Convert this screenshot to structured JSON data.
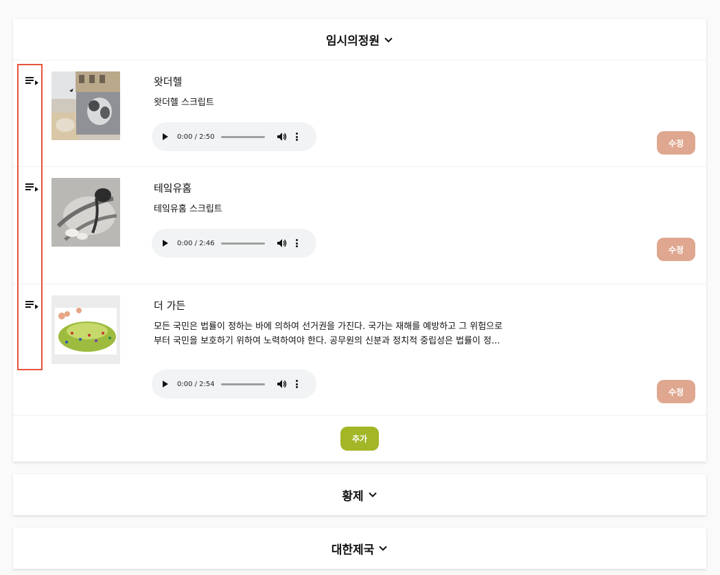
{
  "sections": [
    {
      "title": "임시의정원",
      "expanded": true,
      "items": [
        {
          "title": "왓더헬",
          "description": "왓더헬 스크립트",
          "audio_time": "0:00 / 2:50",
          "edit_label": "수정",
          "thumbnail_icon": "street-and-dog-photo"
        },
        {
          "title": "테잌유홈",
          "description": "테잌유홈 스크립트",
          "audio_time": "0:00 / 2:46",
          "edit_label": "수정",
          "thumbnail_icon": "cat-photo"
        },
        {
          "title": "더 가든",
          "description_line1": "모든 국민은 법률이 정하는 바에 의하여 선거권을 가진다. 국가는 재해를 예방하고 그 위험으로",
          "description_line2": "부터 국민을 보호하기 위하여 노력하여야 한다. 공무원의 신분과 정치적 중립성은 법률이 정...",
          "audio_time": "0:00 / 2:54",
          "edit_label": "수정",
          "thumbnail_icon": "garden-illustration"
        }
      ],
      "add_label": "추가"
    },
    {
      "title": "황제",
      "expanded": false
    },
    {
      "title": "대한제국",
      "expanded": false
    }
  ],
  "colors": {
    "edit_button": "#dfa78f",
    "add_button": "#a3b626",
    "highlight_border": "#e8523a",
    "audio_bg": "#f1f3f4"
  }
}
